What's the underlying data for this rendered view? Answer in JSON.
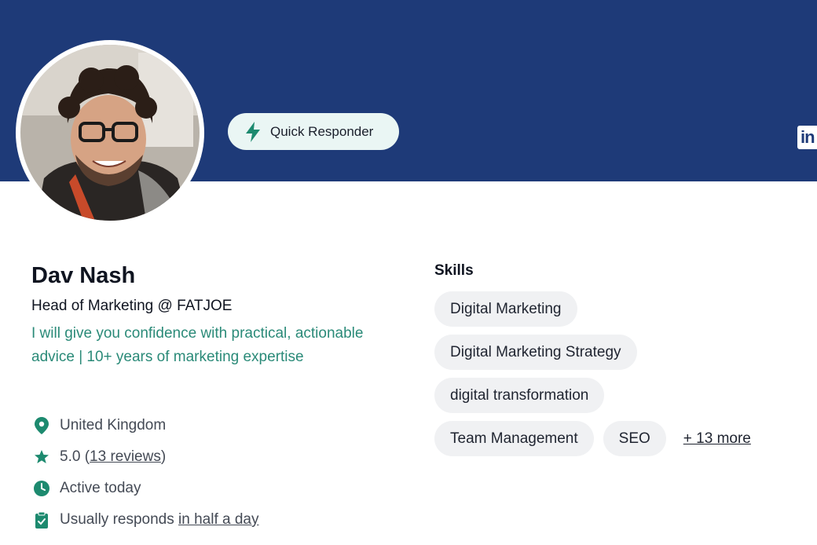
{
  "profile": {
    "name": "Dav Nash",
    "role": "Head of Marketing @ FATJOE",
    "tagline": "I will give you confidence with practical, actionable advice | 10+ years of marketing expertise"
  },
  "badge": {
    "label": "Quick Responder",
    "icon": "lightning-icon"
  },
  "social": {
    "linkedin_label": "in"
  },
  "meta": {
    "location": "United Kingdom",
    "rating_prefix": "5.0 (",
    "reviews_link": "13 reviews",
    "rating_suffix": ")",
    "activity": "Active today",
    "response_prefix": "Usually responds ",
    "response_link": "in half a day"
  },
  "skills": {
    "title": "Skills",
    "items": [
      "Digital Marketing",
      "Digital Marketing Strategy",
      "digital transformation",
      "Team Management",
      "SEO"
    ],
    "more_link": "+ 13 more"
  },
  "colors": {
    "banner": "#1e3a78",
    "accent_teal": "#2a8a78",
    "chip_bg": "#f0f1f3",
    "badge_bg": "#eaf6f4"
  }
}
